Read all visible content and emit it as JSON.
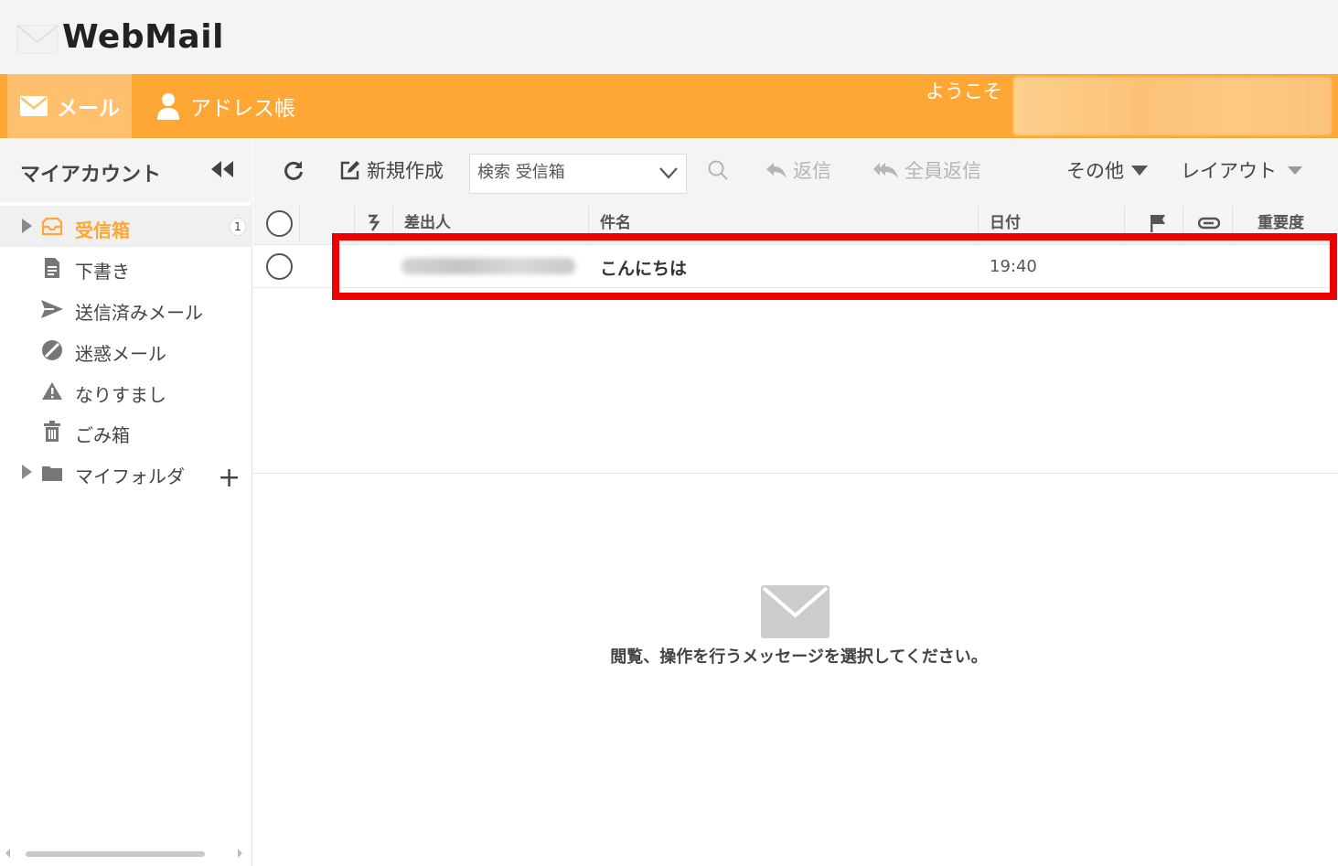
{
  "app": {
    "logo": "WebMail"
  },
  "nav": {
    "tabs": [
      {
        "label": "メール",
        "icon": "mail-icon",
        "active": true
      },
      {
        "label": "アドレス帳",
        "icon": "person-icon",
        "active": false
      }
    ],
    "welcome": "ようこそ"
  },
  "sidebar": {
    "title": "マイアカウント",
    "collapse_icon": "double-chevron-left-icon",
    "folders": [
      {
        "label": "受信箱",
        "icon": "inbox-icon",
        "count": "1",
        "selected": true,
        "expandable": true
      },
      {
        "label": "下書き",
        "icon": "document-icon"
      },
      {
        "label": "送信済みメール",
        "icon": "send-icon"
      },
      {
        "label": "迷惑メール",
        "icon": "block-icon"
      },
      {
        "label": "なりすまし",
        "icon": "warning-icon"
      },
      {
        "label": "ごみ箱",
        "icon": "trash-icon"
      },
      {
        "label": "マイフォルダ",
        "icon": "folder-icon",
        "expandable": true
      }
    ],
    "add_folder": "+"
  },
  "toolbar": {
    "refresh_icon": "refresh-icon",
    "compose": "新規作成",
    "search_placeholder": "検索 受信箱",
    "reply": "返信",
    "reply_all": "全員返信",
    "more": "その他",
    "layout": "レイアウト"
  },
  "list": {
    "columns": {
      "sender": "差出人",
      "subject": "件名",
      "date": "日付",
      "importance": "重要度"
    },
    "messages": [
      {
        "subject": "こんにちは",
        "date": "19:40"
      }
    ]
  },
  "preview": {
    "placeholder": "閲覧、操作を行うメッセージを選択してください。"
  },
  "colors": {
    "accent": "#fea734",
    "highlight": "#ee0000"
  }
}
